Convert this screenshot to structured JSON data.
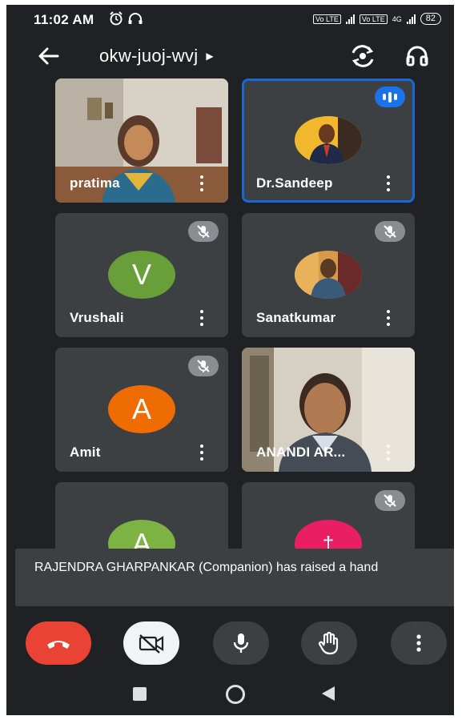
{
  "status_bar": {
    "time": "11:02 AM",
    "volte_1": "Vo LTE",
    "volte_2": "Vo LTE",
    "network": "4G",
    "battery": "82"
  },
  "header": {
    "meeting_code": "okw-juoj-wvj",
    "icons": [
      "back-arrow-icon",
      "switch-camera-icon",
      "headphones-icon"
    ]
  },
  "participants": [
    {
      "name": "pratima",
      "display": "video",
      "muted": false,
      "speaking": false
    },
    {
      "name": "Dr.Sandeep",
      "display": "photo",
      "muted": false,
      "speaking": true
    },
    {
      "name": "Vrushali",
      "display": "letter",
      "initial": "V",
      "color": "#689f38",
      "muted": true
    },
    {
      "name": "Sanatkumar",
      "display": "photo",
      "muted": true
    },
    {
      "name": "Amit",
      "display": "letter",
      "initial": "A",
      "color": "#ef6c00",
      "muted": true
    },
    {
      "name": "ANANDI AR...",
      "display": "video",
      "muted": false
    },
    {
      "name": "",
      "display": "letter",
      "initial": "A",
      "color": "#7cb342",
      "muted": false
    },
    {
      "name": "",
      "display": "letter",
      "initial": "†",
      "color": "#e91e63",
      "muted": true
    }
  ],
  "toast": {
    "message": "RAJENDRA GHARPANKAR (Companion) has raised a hand"
  },
  "controls": [
    "hang-up",
    "camera-off",
    "microphone",
    "raise-hand",
    "more-options"
  ],
  "colors": {
    "background": "#202124",
    "tile": "#3c4043",
    "active_border": "#1967d2",
    "hangup": "#ea4335"
  }
}
